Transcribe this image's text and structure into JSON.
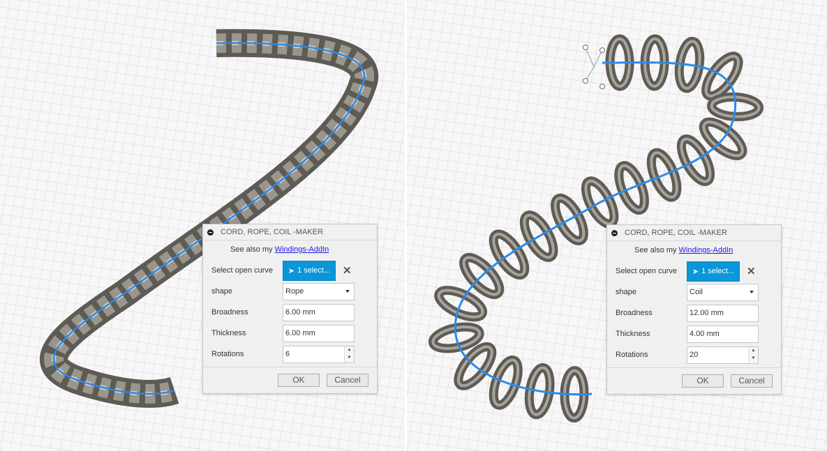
{
  "panels": [
    {
      "title": "CORD, ROPE, COIL -MAKER",
      "see_also_prefix": "See also my",
      "see_also_link": "Windings-AddIn",
      "select_label": "Select open curve",
      "select_value": "1 select...",
      "shape_label": "shape",
      "shape_value": "Rope",
      "broadness_label": "Broadness",
      "broadness_value": "6.00 mm",
      "thickness_label": "Thickness",
      "thickness_value": "6.00 mm",
      "rotations_label": "Rotations",
      "rotations_value": "6",
      "ok": "OK",
      "cancel": "Cancel"
    },
    {
      "title": "CORD, ROPE, COIL -MAKER",
      "see_also_prefix": "See also my",
      "see_also_link": "Windings-AddIn",
      "select_label": "Select open curve",
      "select_value": "1 select...",
      "shape_label": "shape",
      "shape_value": "Coil",
      "broadness_label": "Broadness",
      "broadness_value": "12.00 mm",
      "thickness_label": "Thickness",
      "thickness_value": "4.00 mm",
      "rotations_label": "Rotations",
      "rotations_value": "20",
      "ok": "OK",
      "cancel": "Cancel"
    }
  ],
  "colors": {
    "accent": "#0a96d8",
    "curve": "#2a8be8",
    "model": "#6e6a63"
  }
}
